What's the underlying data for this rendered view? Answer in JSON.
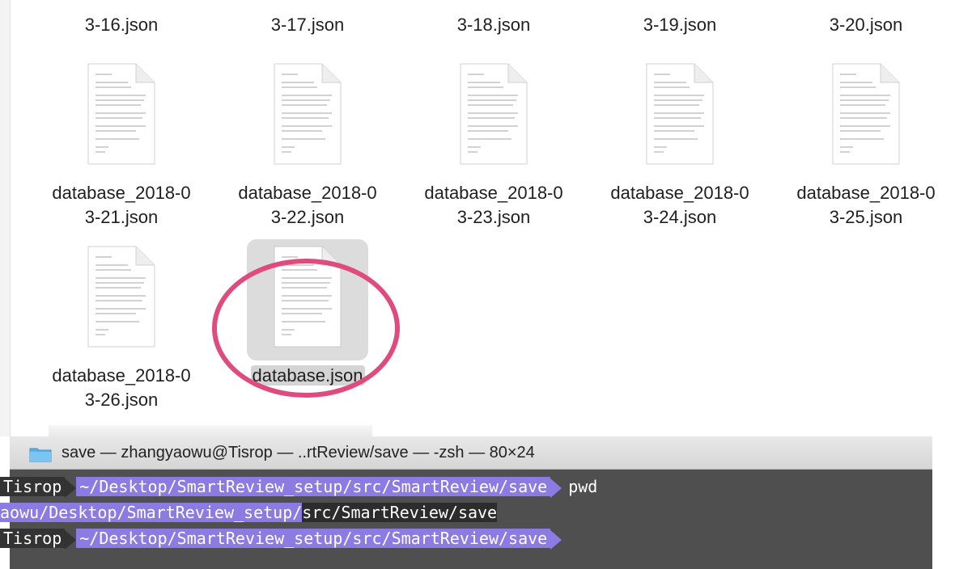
{
  "top_row": [
    "3-16.json",
    "3-17.json",
    "3-18.json",
    "3-19.json",
    "3-20.json"
  ],
  "files": [
    {
      "line1": "database_2018-0",
      "line2": "3-21.json"
    },
    {
      "line1": "database_2018-0",
      "line2": "3-22.json"
    },
    {
      "line1": "database_2018-0",
      "line2": "3-23.json"
    },
    {
      "line1": "database_2018-0",
      "line2": "3-24.json"
    },
    {
      "line1": "database_2018-0",
      "line2": "3-25.json"
    },
    {
      "line1": "database_2018-0",
      "line2": "3-26.json"
    },
    {
      "line1": "database.json",
      "line2": ""
    }
  ],
  "terminal": {
    "title": "save — zhangyaowu@Tisrop — ..rtReview/save — -zsh — 80×24",
    "line1": {
      "host": "Tisrop",
      "path": "~/Desktop/SmartReview_setup/src/SmartReview/save",
      "command": "pwd"
    },
    "line2": {
      "output_prefix": "aowu/Desktop/SmartReview_setup/",
      "output_highlight": "src/SmartReview/save"
    },
    "line3": {
      "host": "Tisrop",
      "path": "~/Desktop/SmartReview_setup/src/SmartReview/save"
    }
  },
  "colors": {
    "annotation": "#e04b7e",
    "prompt_path": "#8b7be3",
    "terminal_bg": "#4f4f4f"
  }
}
